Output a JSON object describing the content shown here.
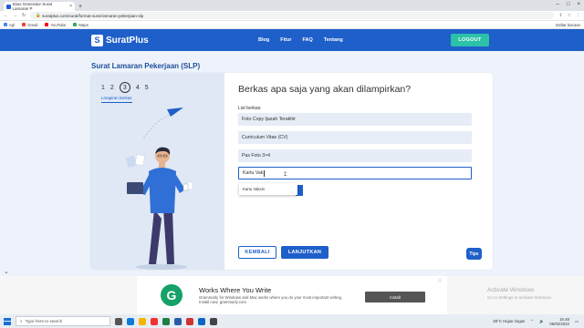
{
  "browser": {
    "tab_title": "Situs Generator Surat Lamaran P",
    "url": "suratplus.com/surat/format-surat-lamaran-pekerjaan-slp",
    "bookmarks": [
      "Apl",
      "Gmail",
      "YouTube",
      "Maps"
    ],
    "reading_list": "Daftar bacaan"
  },
  "nav": {
    "brand": "SuratPlus",
    "links": [
      "Blog",
      "Fitur",
      "FAQ",
      "Tentang"
    ],
    "logout": "LOGOUT",
    "brand_color": "#1e5fc9",
    "logout_color": "#2bc2a7"
  },
  "page": {
    "title": "Surat Lamaran Pekerjaan (SLP)",
    "steps": [
      "1",
      "2",
      "3",
      "4",
      "5"
    ],
    "active_step": "3",
    "step_caption": "Lmapiran berkas",
    "question": "Berkas apa saja yang akan dilampirkan?",
    "list_label": "List berkas:",
    "items": [
      "Foto Copy Ijazah Terakhir",
      "Curriculum Vitae (CV)",
      "Pas Foto 3×4"
    ],
    "input_value": "Kartu Vak",
    "suggestion": "Kartu Vaksin",
    "back_label": "KEMBALI",
    "next_label": "LANJUTKAN",
    "tips_label": "Tips"
  },
  "ad": {
    "title": "Works Where You Write",
    "desc": "Grammarly for Windows and Mac works where you do your most important writing. Install now: grammarly.com",
    "install": "Install",
    "activate_title": "Activate Windows",
    "activate_desc": "Go to Settings to activate Windows."
  },
  "taskbar": {
    "search_placeholder": "Type here to search",
    "weather": "28°C Hujan ringan",
    "time": "15.48",
    "date": "06/02/2022"
  }
}
